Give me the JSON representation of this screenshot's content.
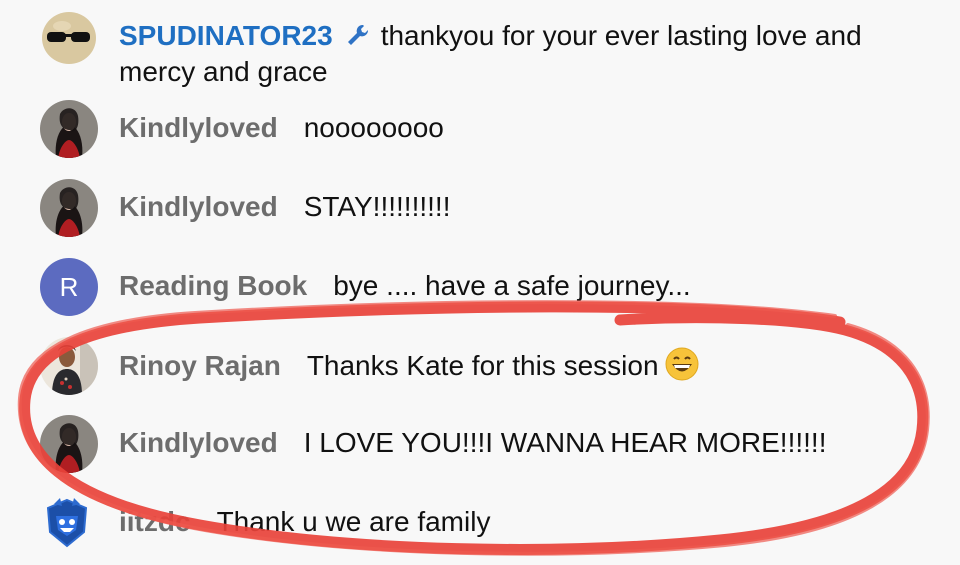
{
  "messages": [
    {
      "author": "SPUDINATOR23",
      "text": "thankyou for your ever lasting love and mercy and grace",
      "role": "owner",
      "badge": "wrench-icon"
    },
    {
      "author": "Kindlyloved",
      "text": "noooooooo"
    },
    {
      "author": "Kindlyloved",
      "text": "STAY!!!!!!!!!!"
    },
    {
      "author": "Reading Book",
      "text": "bye .... have a safe journey...",
      "avatar_letter": "R"
    },
    {
      "author": "Rinoy Rajan",
      "text": "Thanks Kate for this session",
      "emoji": "grinning-face-emoji"
    },
    {
      "author": "Kindlyloved",
      "text": "I LOVE YOU!!!I WANNA HEAR MORE!!!!!!"
    },
    {
      "author": "iitzdc",
      "text": "Thank u we are family"
    }
  ],
  "colors": {
    "owner_name": "#1f6fc2",
    "author_name": "#6d6d6d",
    "annotation_stroke": "#e8423a",
    "letter_avatar_bg": "#5c6bc0"
  }
}
